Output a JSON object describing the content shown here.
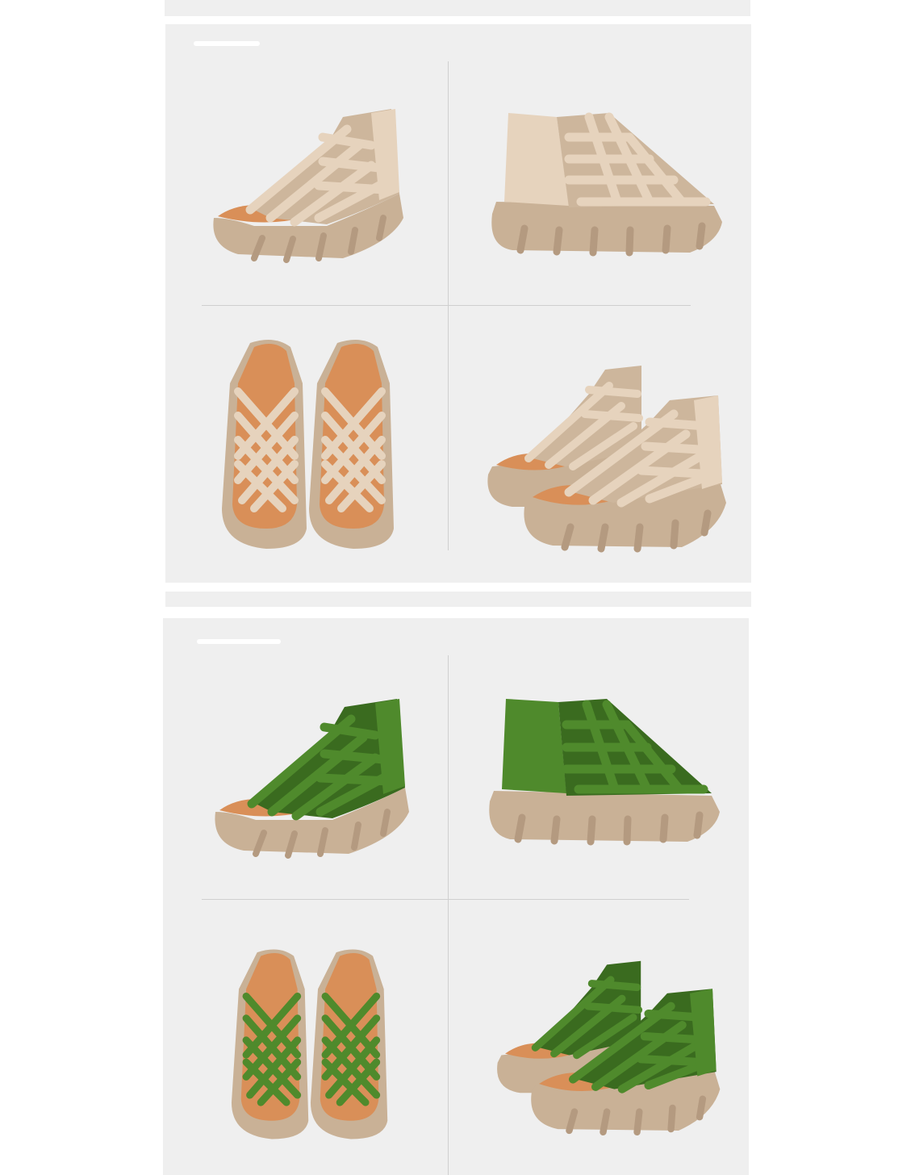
{
  "colors": {
    "page_background": "#ffffff",
    "panel_background": "#efefef",
    "sole": "#c9b196",
    "sole_shadow": "#b49a80",
    "insole": "#d98f58",
    "beige_leather": "#e6d3bd",
    "beige_leather_dark": "#cdb69c",
    "green_leather": "#4f8a2c",
    "green_leather_dark": "#3a6b1f",
    "divider": "#cfcfcf"
  },
  "panels": [
    {
      "colorway": "beige",
      "views": [
        "side-angle",
        "back-side",
        "top-pair",
        "pair-angle"
      ]
    },
    {
      "colorway": "green",
      "views": [
        "side-angle",
        "back-side",
        "top-pair",
        "pair-angle"
      ]
    }
  ]
}
